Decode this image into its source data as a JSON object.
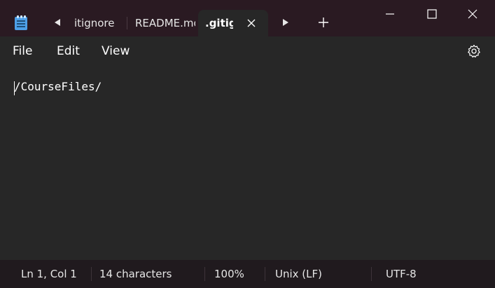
{
  "titlebar": {
    "tabs": [
      {
        "label": "itignore"
      },
      {
        "label": "README.md"
      },
      {
        "label": ".gitignore",
        "active": true
      }
    ],
    "icons": {
      "app": "notepad-icon",
      "scroll_left": "chevron-left-icon",
      "scroll_right": "chevron-right-icon",
      "new_tab": "plus-icon",
      "close_tab": "close-icon",
      "minimize": "minimize-icon",
      "maximize": "maximize-icon",
      "close_window": "close-window-icon"
    }
  },
  "menu": {
    "items": [
      "File",
      "Edit",
      "View"
    ],
    "settings_icon": "gear-icon"
  },
  "editor": {
    "content": "/CourseFiles/"
  },
  "status": {
    "position": "Ln 1, Col 1",
    "characters": "14 characters",
    "zoom": "100%",
    "line_ending": "Unix (LF)",
    "encoding": "UTF-8"
  },
  "colors": {
    "titlebar_bg": "#2a1a22",
    "editor_bg": "#272727",
    "statusbar_bg": "#201a1e",
    "text": "#ffffff"
  }
}
